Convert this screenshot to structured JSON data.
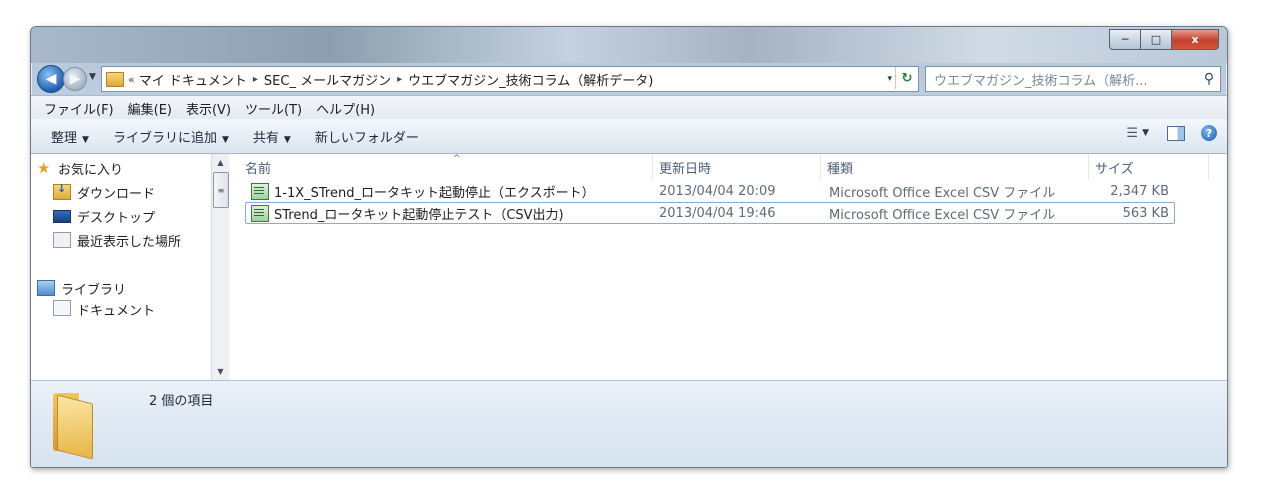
{
  "window": {
    "title_buttons": {
      "minimize": "─",
      "maximize": "□",
      "close": "x"
    }
  },
  "address": {
    "overflow": "«",
    "crumbs": [
      "マイ ドキュメント",
      "SEC_ メールマガジン",
      "ウエブマガジン_技術コラム（解析データ)"
    ],
    "separator": "▸",
    "dropdown": "▾",
    "refresh_icon": "refresh-icon"
  },
  "search": {
    "placeholder": "ウエブマガジン_技術コラム（解析...",
    "icon": "search-icon"
  },
  "menubar": [
    "ファイル(F)",
    "編集(E)",
    "表示(V)",
    "ツール(T)",
    "ヘルプ(H)"
  ],
  "commands": [
    {
      "label": "整理",
      "has_dropdown": true
    },
    {
      "label": "ライブラリに追加",
      "has_dropdown": true
    },
    {
      "label": "共有",
      "has_dropdown": true
    },
    {
      "label": "新しいフォルダー",
      "has_dropdown": false
    }
  ],
  "nav": {
    "items": [
      {
        "label": "お気に入り",
        "icon": "star-icon"
      },
      {
        "label": "ダウンロード",
        "icon": "downloads-folder-icon"
      },
      {
        "label": "デスクトップ",
        "icon": "desktop-icon"
      },
      {
        "label": "最近表示した場所",
        "icon": "recent-places-icon"
      },
      {
        "label": "",
        "icon": ""
      },
      {
        "label": "ライブラリ",
        "icon": "library-icon"
      },
      {
        "label": "ドキュメント",
        "icon": "documents-icon"
      }
    ]
  },
  "columns": [
    "名前",
    "更新日時",
    "種類",
    "サイズ"
  ],
  "files": [
    {
      "name": "1-1X_STrend_ロータキット起動停止（エクスポート）",
      "date": "2013/04/04 20:09",
      "type": "Microsoft Office Excel CSV ファイル",
      "size": "2,347 KB",
      "selected": false
    },
    {
      "name": "STrend_ロータキット起動停止テスト（CSV出力)",
      "date": "2013/04/04 19:46",
      "type": "Microsoft Office Excel CSV ファイル",
      "size": "563 KB",
      "selected": true
    }
  ],
  "details": {
    "item_count": "2 個の項目"
  },
  "colors": {
    "accent": "#1f5fb0",
    "selection_border": "#84acdd",
    "folder": "#e8b444"
  }
}
